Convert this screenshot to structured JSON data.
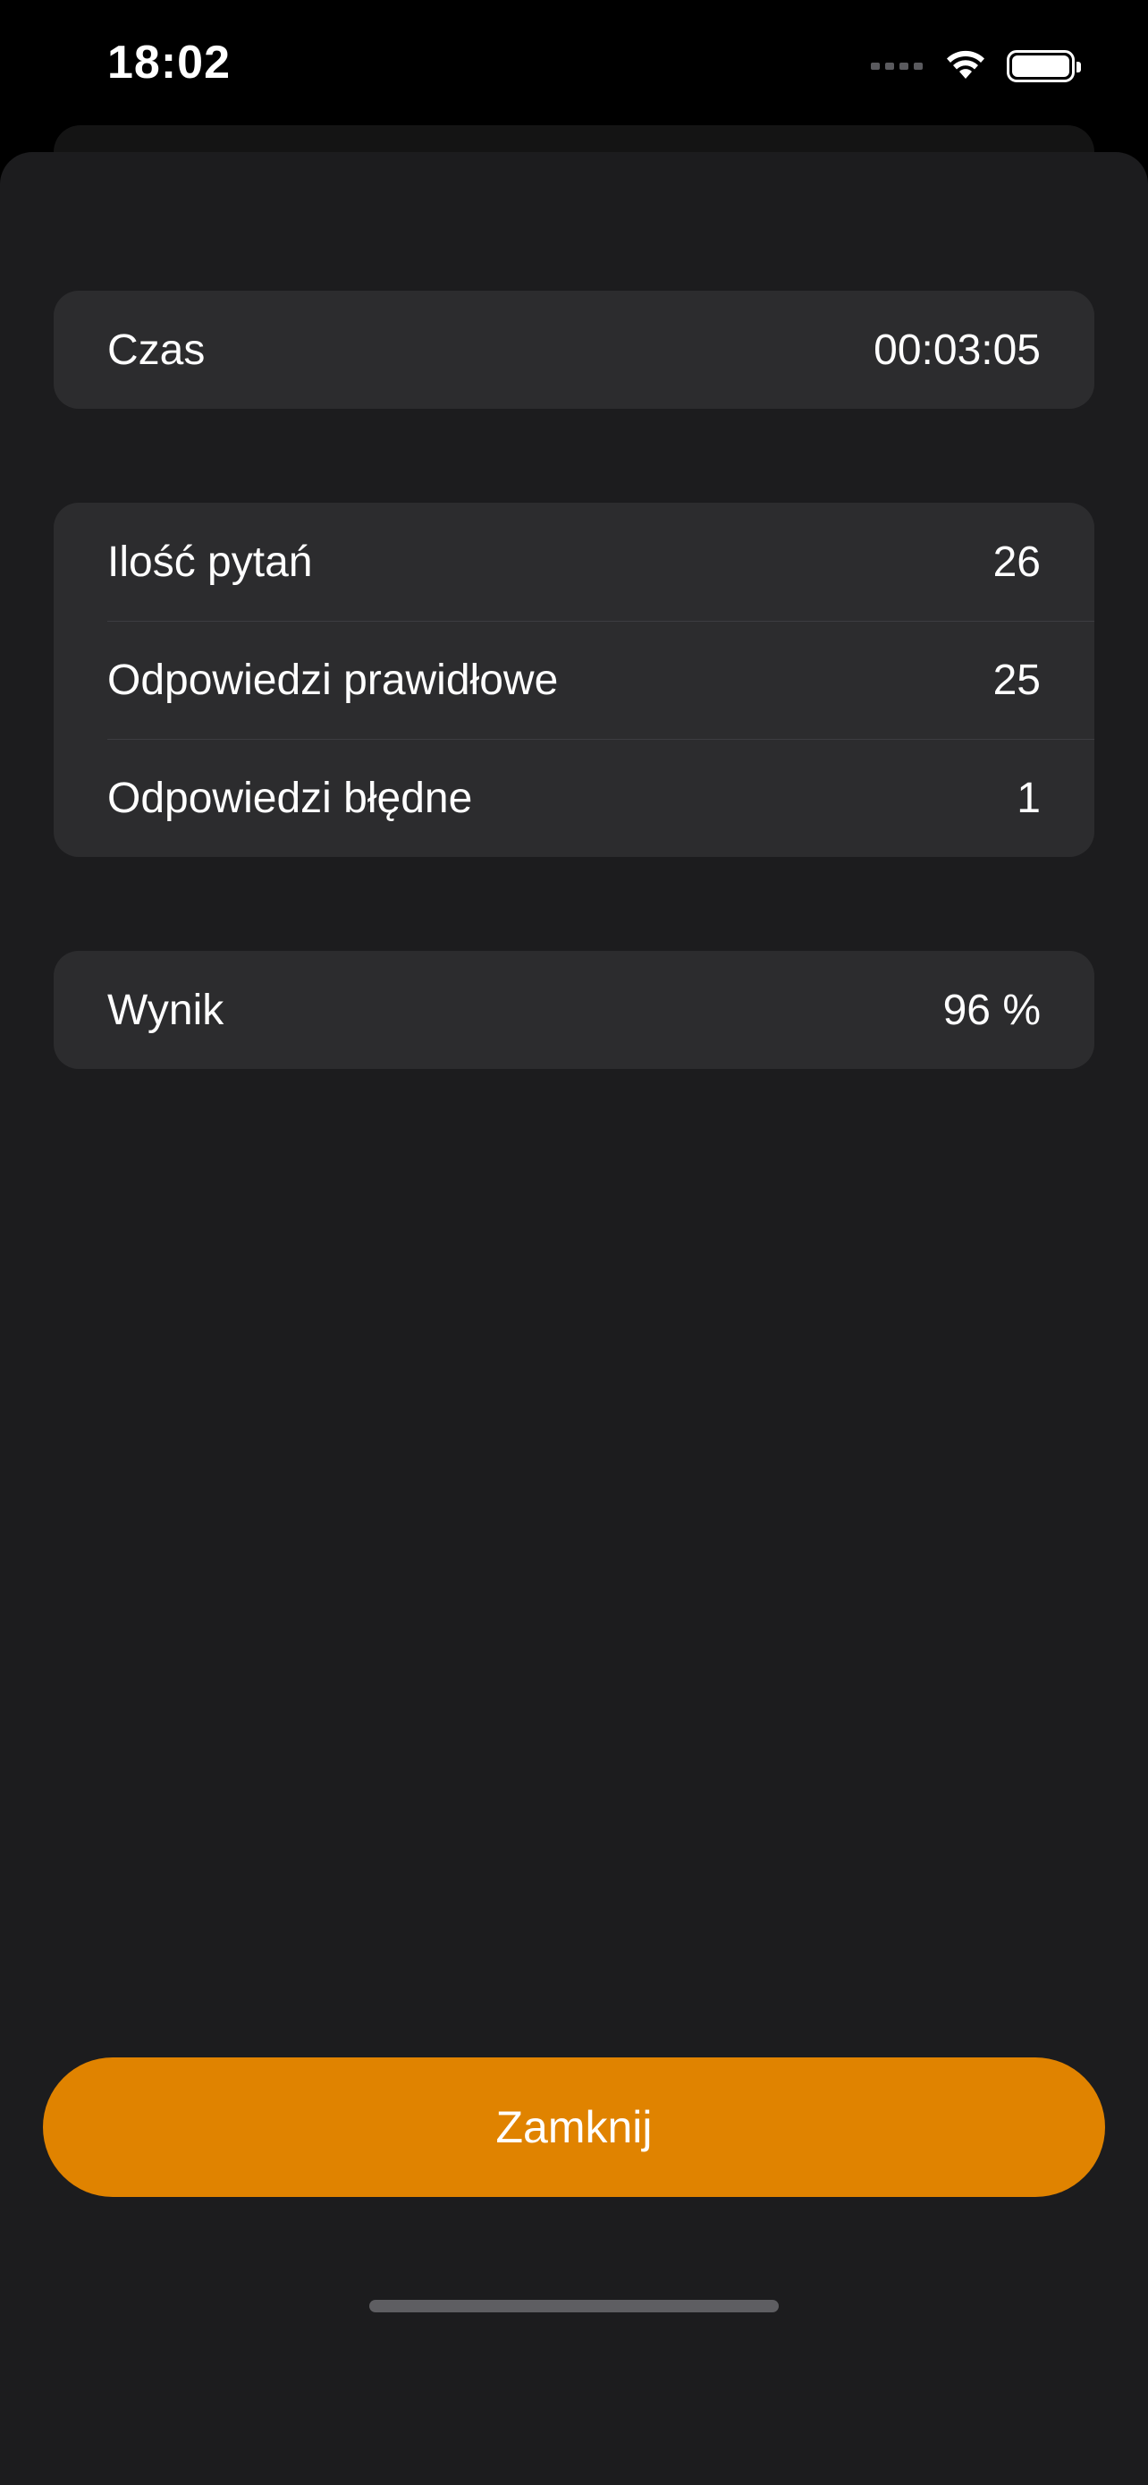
{
  "status_bar": {
    "time": "18:02",
    "icons": [
      "cellular-signal-icon",
      "wifi-icon",
      "battery-icon"
    ]
  },
  "time_card": {
    "label": "Czas",
    "value": "00:03:05"
  },
  "stats_card": {
    "rows": [
      {
        "label": "Ilość pytań",
        "value": "26"
      },
      {
        "label": "Odpowiedzi prawidłowe",
        "value": "25"
      },
      {
        "label": "Odpowiedzi błędne",
        "value": "1"
      }
    ]
  },
  "score_card": {
    "label": "Wynik",
    "value": "96 %"
  },
  "close_button": {
    "label": "Zamknij"
  },
  "colors": {
    "accent": "#e08300",
    "sheet_background": "#1c1c1e",
    "card_background": "#2c2c2e"
  }
}
